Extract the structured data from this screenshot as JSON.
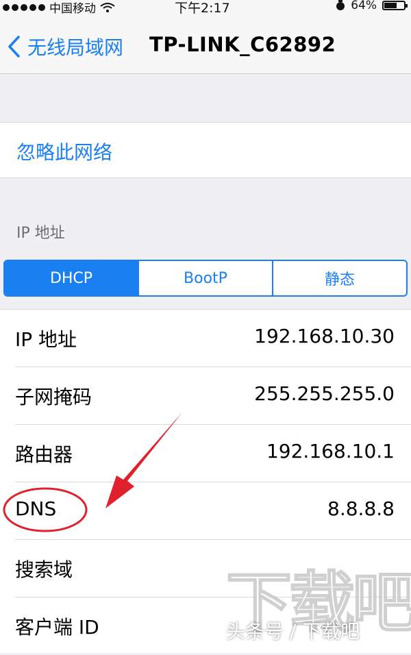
{
  "status": {
    "carrier": "中国移动",
    "time": "下午2:17",
    "battery": "64%",
    "battery_level": 0.64
  },
  "nav": {
    "back_label": "无线局域网",
    "title": "TP-LINK_C62892"
  },
  "forget_label": "忽略此网络",
  "ip_section_header": "IP 地址",
  "segmented": {
    "options": [
      "DHCP",
      "BootP",
      "静态"
    ],
    "selected": "DHCP"
  },
  "rows": [
    {
      "label": "IP 地址",
      "value": "192.168.10.30"
    },
    {
      "label": "子网掩码",
      "value": "255.255.255.0"
    },
    {
      "label": "路由器",
      "value": "192.168.10.1"
    },
    {
      "label": "DNS",
      "value": "8.8.8.8"
    },
    {
      "label": "搜索域",
      "value": ""
    },
    {
      "label": "客户端 ID",
      "value": ""
    }
  ],
  "watermark": {
    "logo_text": "下载吧",
    "caption": "头条号 / 下载吧"
  },
  "colors": {
    "accent": "#1a7ff0",
    "annotation": "#e0202a"
  }
}
